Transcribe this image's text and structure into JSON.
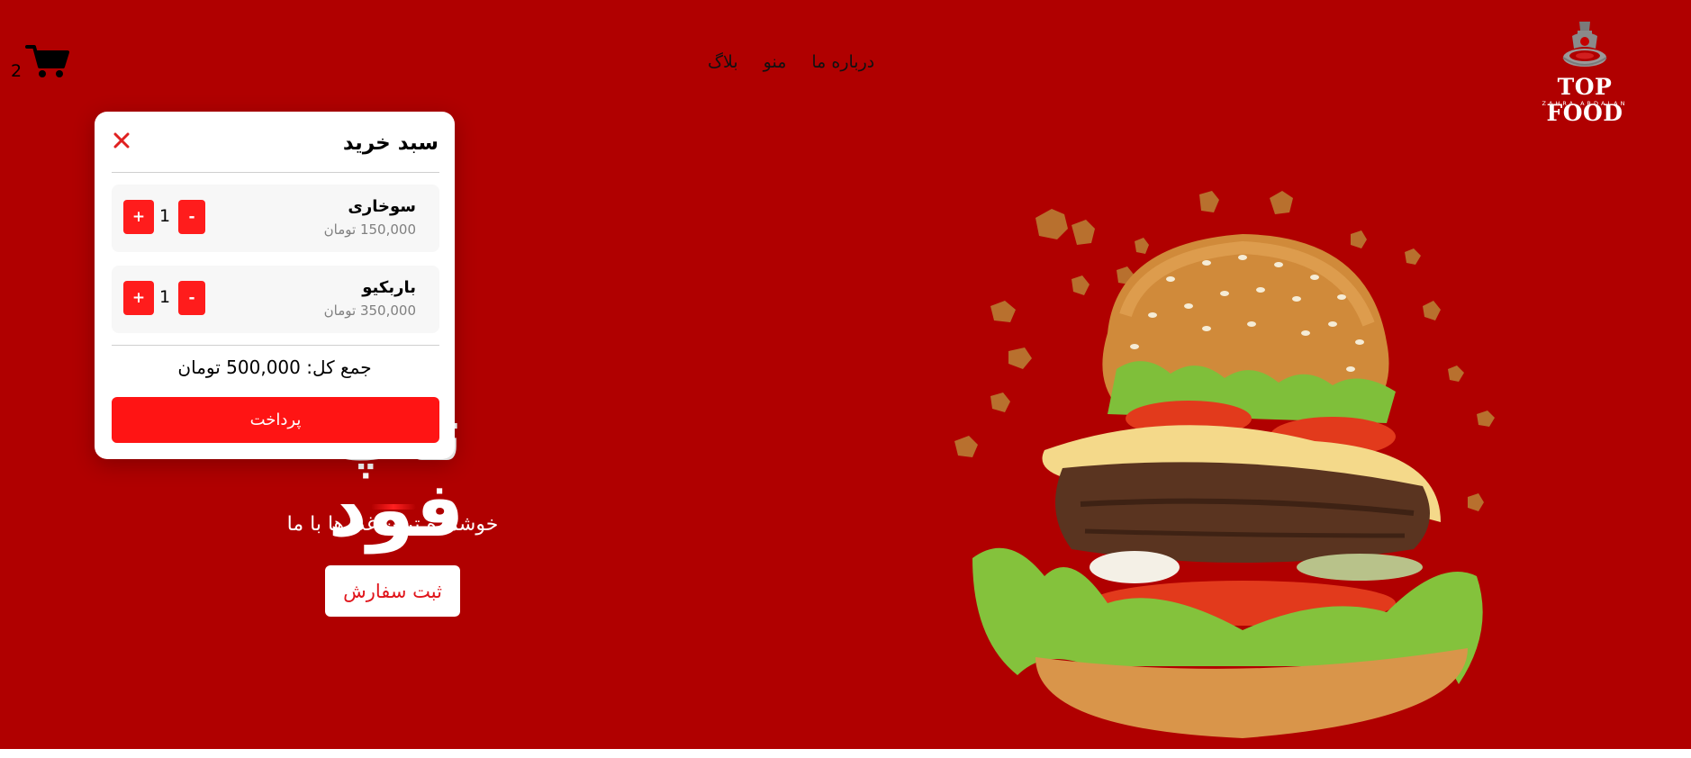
{
  "brand": {
    "logo_text": "TOP FOOD",
    "logo_subtext": "ZAHRA ARDALAN",
    "logo_icon": "chef-plate-icon"
  },
  "nav": {
    "items": [
      {
        "label": "بلاگ"
      },
      {
        "label": "منو"
      },
      {
        "label": "درباره ما"
      }
    ]
  },
  "cart_icon": {
    "icon": "shopping-cart-icon",
    "count": "2"
  },
  "hero": {
    "title": "تاپ فود",
    "subtitle": "خوشمزه ترین غذا ها با ما",
    "order_button": "ثبت سفارش",
    "image_icon": "burger-image"
  },
  "cart": {
    "title": "سبد خرید",
    "close_icon": "close-icon",
    "items": [
      {
        "name": "سوخاری",
        "price": "150,000 تومان",
        "quantity": "1",
        "minus": "-",
        "plus": "+"
      },
      {
        "name": "باربکیو",
        "price": "350,000 تومان",
        "quantity": "1",
        "minus": "-",
        "plus": "+"
      }
    ],
    "total": "جمع کل: 500,000 تومان",
    "pay_button": "پرداخت"
  },
  "colors": {
    "background": "#b00000",
    "accent": "#ff1c1c",
    "panel": "#ffffff"
  }
}
